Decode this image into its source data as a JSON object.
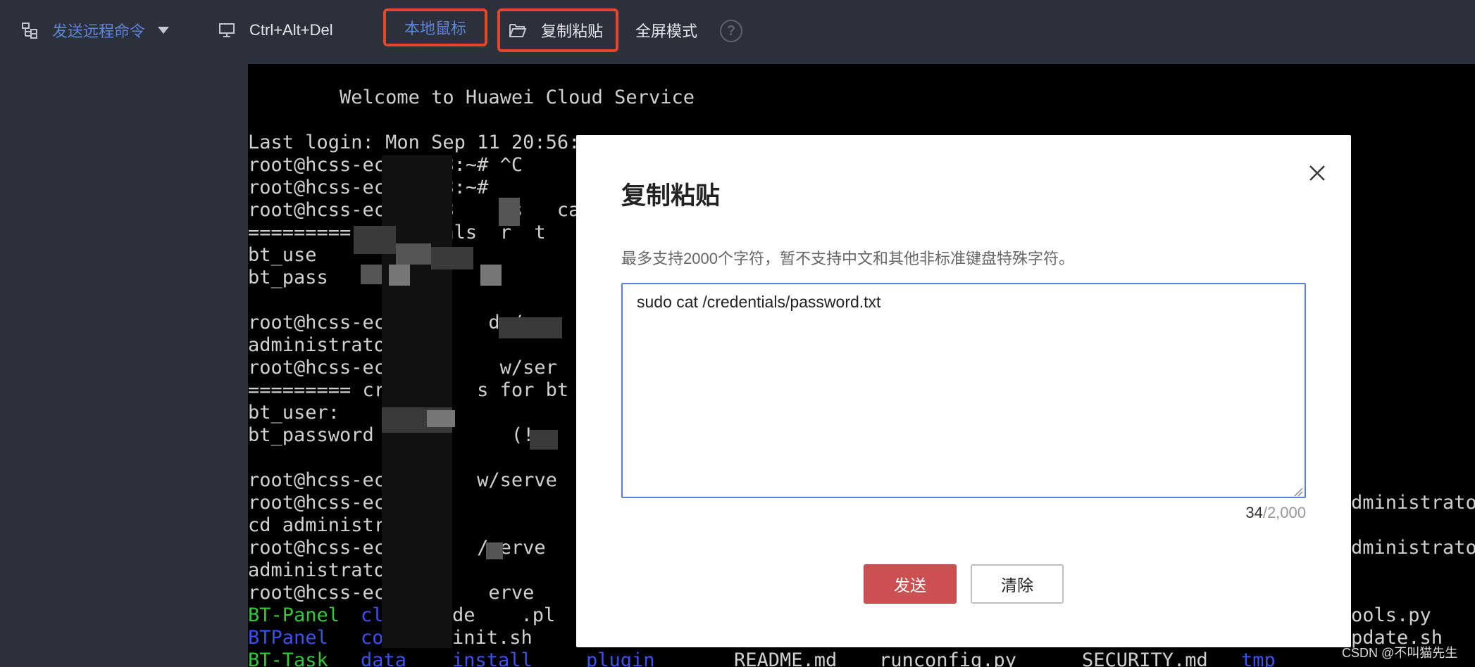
{
  "toolbar": {
    "send_remote_command": "发送远程命令",
    "ctrl_alt_del": "Ctrl+Alt+Del",
    "local_mouse": "本地鼠标",
    "copy_paste": "复制粘贴",
    "fullscreen": "全屏模式",
    "help": "?"
  },
  "terminal": {
    "lines": [
      "        Welcome to Huawei Cloud Service",
      "Last login: Mon Sep 11 20:56:",
      "root@hcss-ecs-06c8:~# ^C",
      "root@hcss-ecs-06c8:~#",
      "root@hcss-ec  06c8     s   ca",
      "========= cr    ials  r  t",
      "bt_use        trato",
      "bt_pass",
      "root@hcss-ecs        d /",
      "administrator",
      "root@hcss-ecs  6c     w/ser",
      "========= cr    t   s for bt",
      "bt_user:",
      "bt_password            (!",
      "root@hcss-ecs-      w/serve",
      "root@hcss-ecs-",
      "cd administrat",
      "root@hcss-ecs-      /serve",
      "administrator",
      "root@hcss-ecs-06     erve"
    ],
    "colored_row_1": [
      "BT-Panel",
      "class",
      "de    .pl"
    ],
    "colored_row_2": [
      "BTPanel",
      "config",
      "init.sh"
    ],
    "colored_row_3": [
      "BT-Task",
      "data",
      "install",
      "plugin",
      "README.md",
      "runconfig.py",
      "SECURITY.md",
      "tmp"
    ],
    "right_1": "dministrator",
    "right_2": "dministrator",
    "right_3": "ools.py",
    "right_4": "pdate.sh"
  },
  "dialog": {
    "title": "复制粘贴",
    "hint": "最多支持2000个字符，暂不支持中文和其他非标准键盘特殊字符。",
    "textarea_value": "sudo cat /credentials/password.txt",
    "char_count": "34",
    "char_limit": "/2,000",
    "send": "发送",
    "clear": "清除"
  },
  "watermark": "CSDN @不叫猫先生",
  "colors": {
    "toolbar_bg": "#2b303b",
    "accent_blue": "#5d86d8",
    "highlight_red": "#e8452c",
    "send_button": "#cb5052",
    "terminal_green": "#31c93a",
    "terminal_blue": "#3a50f0"
  }
}
